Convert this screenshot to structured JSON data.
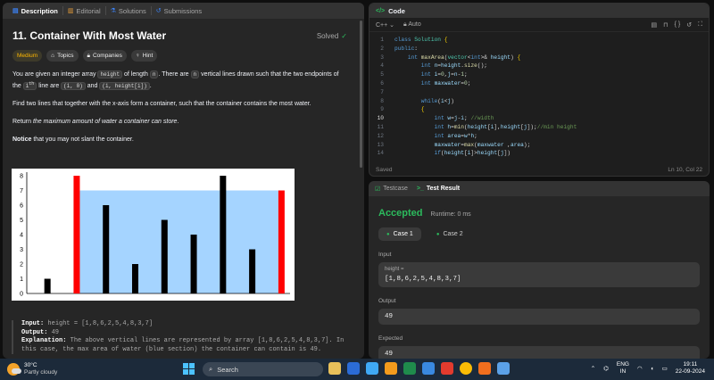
{
  "left_tabs": [
    {
      "label": "Description",
      "icon": "description-icon"
    },
    {
      "label": "Editorial",
      "icon": "editorial-icon"
    },
    {
      "label": "Solutions",
      "icon": "solutions-icon"
    },
    {
      "label": "Submissions",
      "icon": "submissions-icon"
    }
  ],
  "problem": {
    "title": "11. Container With Most Water",
    "status": "Solved",
    "difficulty": "Medium",
    "tags": [
      "Topics",
      "Companies",
      "Hint"
    ],
    "para1_a": "You are given an integer array ",
    "para1_code1": "height",
    "para1_b": " of length ",
    "para1_code2": "n",
    "para1_c": ". There are ",
    "para1_code3": "n",
    "para1_d": " vertical lines drawn such that the two endpoints of the ",
    "para1_sup": "i",
    "para1_supth": "th",
    "para1_e": " line are ",
    "para1_code4": "(i, 0)",
    "para1_f": " and ",
    "para1_code5": "(i, height[i])",
    "para1_g": ".",
    "para2": "Find two lines that together with the x-axis form a container, such that the container contains the most water.",
    "para3_a": "Return ",
    "para3_it": "the maximum amount of water a container can store",
    "para3_b": ".",
    "para4_bold": "Notice",
    "para4_rest": " that you may not slant the container.",
    "example_title": "Example 1:",
    "example_input_label": "Input:",
    "example_input": " height = [1,8,6,2,5,4,8,3,7]",
    "example_output_label": "Output:",
    "example_output": " 49",
    "example_expl_label": "Explanation:",
    "example_expl": " The above vertical lines are represented by array [1,8,6,2,5,4,8,3,7]. In this case, the max area of water (blue section) the container can contain is 49."
  },
  "chart_data": {
    "type": "bar",
    "categories": [
      "0",
      "1",
      "2",
      "3",
      "4",
      "5",
      "6",
      "7",
      "8"
    ],
    "values": [
      1,
      8,
      6,
      2,
      5,
      4,
      8,
      3,
      7
    ],
    "highlight_indices": [
      1,
      8
    ],
    "water_level": 7,
    "water_range": [
      1,
      8
    ],
    "ylim": [
      0,
      8
    ],
    "yticks": [
      "0",
      "1",
      "2",
      "3",
      "4",
      "5",
      "6",
      "7",
      "8"
    ],
    "colors": {
      "bar": "#000000",
      "highlight": "#ff0000",
      "water": "#a5d4ff"
    },
    "title": "",
    "xlabel": "",
    "ylabel": ""
  },
  "code_panel": {
    "title": "Code",
    "language": "C++",
    "mode": "Auto",
    "lines": [
      {
        "n": "1",
        "html": "<span class='kw'>class</span> <span class='ty'>Solution</span> <span class='br'>{</span>"
      },
      {
        "n": "2",
        "html": "<span class='kw'>public</span>:"
      },
      {
        "n": "3",
        "html": "    <span class='kw'>int</span> <span class='fn'>maxArea</span>(<span class='ty'>vector</span>&lt;<span class='kw'>int</span>&gt;&amp; <span class='vr'>height</span>) <span class='br'>{</span>"
      },
      {
        "n": "4",
        "html": "        <span class='kw'>int</span> <span class='vr'>n</span>=<span class='vr'>height</span>.<span class='fn'>size</span>();"
      },
      {
        "n": "5",
        "html": "        <span class='kw'>int</span> <span class='vr'>i</span>=<span class='nm'>0</span>,<span class='vr'>j</span>=<span class='vr'>n</span>-<span class='nm'>1</span>;"
      },
      {
        "n": "6",
        "html": "        <span class='kw'>int</span> <span class='vr'>maxwater</span>=<span class='nm'>0</span>;"
      },
      {
        "n": "7",
        "html": ""
      },
      {
        "n": "8",
        "html": "        <span class='kw'>while</span>(<span class='vr'>i</span>&lt;<span class='vr'>j</span>)"
      },
      {
        "n": "9",
        "html": "        <span class='br'>{</span>"
      },
      {
        "n": "10",
        "html": "            <span class='kw'>int</span> <span class='vr'>w</span>=<span class='vr'>j</span>-<span class='vr'>i</span>; <span class='cm'>//width</span>"
      },
      {
        "n": "11",
        "html": "            <span class='kw'>int</span> <span class='vr'>h</span>=<span class='fn'>min</span>(<span class='vr'>height</span>[<span class='vr'>i</span>],<span class='vr'>height</span>[<span class='vr'>j</span>]);<span class='cm'>//min height</span>"
      },
      {
        "n": "12",
        "html": "            <span class='kw'>int</span> <span class='vr'>area</span>=<span class='vr'>w</span>*<span class='vr'>h</span>;"
      },
      {
        "n": "13",
        "html": "            <span class='vr'>maxwater</span>=<span class='fn'>max</span>(<span class='vr'>maxwater</span> ,<span class='vr'>area</span>);"
      },
      {
        "n": "14",
        "html": "            <span class='kw'>if</span>(<span class='vr'>height</span>[<span class='vr'>i</span>]&gt;<span class='vr'>height</span>[<span class='vr'>j</span>])"
      }
    ],
    "saved": "Saved",
    "cursor": "Ln 10, Col 22"
  },
  "test_panel": {
    "tab_testcase": "Testcase",
    "tab_result": "Test Result",
    "status": "Accepted",
    "runtime": "Runtime: 0 ms",
    "cases": [
      "Case 1",
      "Case 2"
    ],
    "input_label": "Input",
    "input_var": "height =",
    "input_value": "[1,8,6,2,5,4,8,3,7]",
    "output_label": "Output",
    "output_value": "49",
    "expected_label": "Expected",
    "expected_value": "49"
  },
  "taskbar": {
    "temp": "30°C",
    "weather": "Partly cloudy",
    "search_placeholder": "Search",
    "lang_top": "ENG",
    "lang_bottom": "IN",
    "time": "19:11",
    "date": "22-09-2024"
  }
}
